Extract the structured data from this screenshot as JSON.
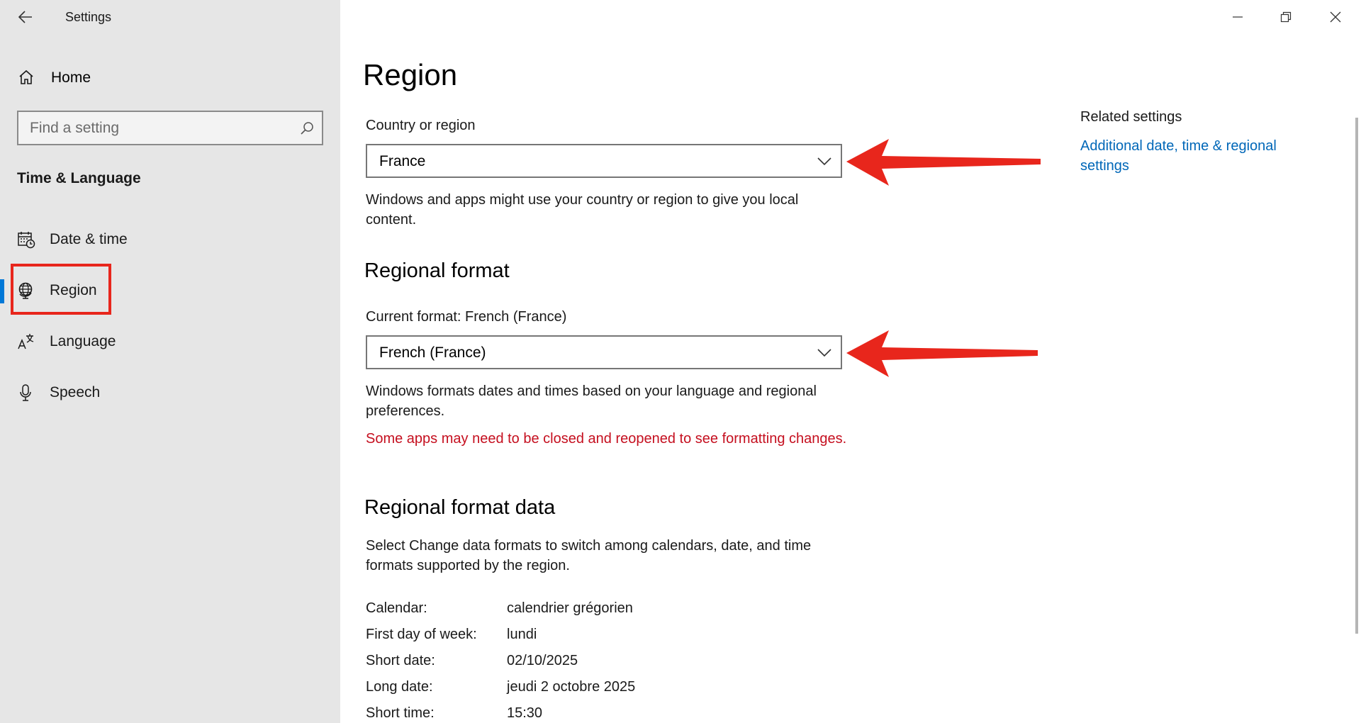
{
  "window": {
    "app_title": "Settings",
    "controls": [
      "minimize-icon",
      "restore-icon",
      "close-icon"
    ]
  },
  "sidebar": {
    "home_label": "Home",
    "search": {
      "placeholder": "Find a setting",
      "value": ""
    },
    "section_title": "Time & Language",
    "items": [
      {
        "label": "Date & time",
        "icon": "calendar-clock-icon",
        "selected": false
      },
      {
        "label": "Region",
        "icon": "globe-icon",
        "selected": true
      },
      {
        "label": "Language",
        "icon": "language-icon",
        "selected": false
      },
      {
        "label": "Speech",
        "icon": "microphone-icon",
        "selected": false
      }
    ]
  },
  "main": {
    "title": "Region",
    "country": {
      "label": "Country or region",
      "value": "France",
      "description": "Windows and apps might use your country or region to give you local content."
    },
    "regional_format": {
      "heading": "Regional format",
      "label": "Current format: French (France)",
      "value": "French (France)",
      "description": "Windows formats dates and times based on your language and regional preferences.",
      "warning": "Some apps may need to be closed and reopened to see formatting changes."
    },
    "format_data": {
      "heading": "Regional format data",
      "description": "Select Change data formats to switch among calendars, date, and time formats supported by the region.",
      "rows": [
        {
          "key": "Calendar:",
          "value": "calendrier grégorien"
        },
        {
          "key": "First day of week:",
          "value": "lundi"
        },
        {
          "key": "Short date:",
          "value": "02/10/2025"
        },
        {
          "key": "Long date:",
          "value": "jeudi 2 octobre 2025"
        },
        {
          "key": "Short time:",
          "value": "15:30"
        }
      ]
    }
  },
  "related": {
    "title": "Related settings",
    "link": "Additional date, time & regional settings"
  },
  "colors": {
    "accent": "#0078d7",
    "link": "#0067b8",
    "warning": "#c50f1f",
    "annotation": "#e8261c",
    "sidebar_bg": "#e6e6e6"
  }
}
